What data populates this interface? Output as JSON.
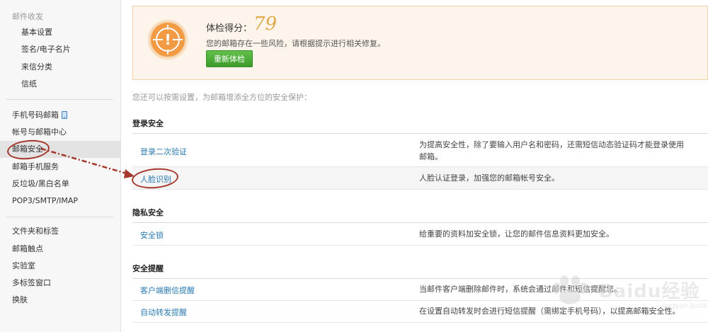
{
  "sidebar": {
    "group_heading": "邮件收发",
    "mail_items": [
      "基本设置",
      "签名/电子名片",
      "来信分类",
      "信纸"
    ],
    "account_items": [
      {
        "label": "手机号码邮箱",
        "icon": "phone-icon"
      },
      {
        "label": "帐号与邮箱中心"
      },
      {
        "label": "邮箱安全",
        "active": true
      },
      {
        "label": "邮箱手机服务"
      },
      {
        "label": "反垃圾/黑白名单"
      },
      {
        "label": "POP3/SMTP/IMAP"
      }
    ],
    "other_items": [
      "文件夹和标签",
      "邮箱触点",
      "实验室",
      "多标签窗口",
      "换肤"
    ]
  },
  "score": {
    "label": "体检得分：",
    "value": "79",
    "description": "您的邮箱存在一些风险，请根据提示进行相关修复。",
    "recheck_button": "重新体检",
    "icon": "warning-target-icon",
    "value_color": "#e0a94a"
  },
  "hint": "您还可以按需设置，为邮箱增添全方位的安全保护：",
  "sections": {
    "login": {
      "title": "登录安全",
      "rows": [
        {
          "link": "登录二次验证",
          "desc": "为提高安全性，除了要输入用户名和密码，还需短信动态验证码才能登录使用邮箱。"
        },
        {
          "link": "人脸识别",
          "desc": "人脸认证登录，加强您的邮箱帐号安全。"
        }
      ]
    },
    "privacy": {
      "title": "隐私安全",
      "rows": [
        {
          "link": "安全锁",
          "desc": "给重要的资料加安全锁，让您的邮件信息资料更加安全。"
        }
      ]
    },
    "alerts": {
      "title": "安全提醒",
      "rows": [
        {
          "link": "客户端删信提醒",
          "desc": "当邮件客户端删除邮件时，系统会通过邮件和短信提醒您。"
        },
        {
          "link": "自动转发提醒",
          "desc": "在设置自动转发时会进行短信提醒（需绑定手机号码），以提高邮箱安全性。"
        }
      ]
    }
  },
  "colors": {
    "link": "#2a7ab0",
    "annotation": "#a5382c",
    "button": "#4aab35"
  },
  "watermark": {
    "text": "Baidu经验",
    "sub": "jingyan.baidu.com"
  }
}
